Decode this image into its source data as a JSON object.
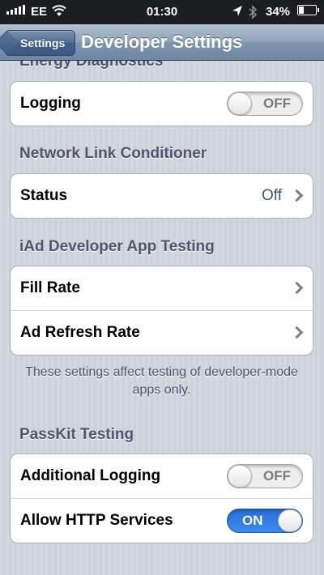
{
  "status_bar": {
    "carrier": "EE",
    "time": "01:30",
    "battery_percent": "34%",
    "battery_level": 0.34
  },
  "nav": {
    "back_label": "Settings",
    "title": "Developer Settings"
  },
  "sections": {
    "energy_header": "Energy Diagnostics",
    "logging_label": "Logging",
    "logging_toggle": "OFF",
    "network_header": "Network Link Conditioner",
    "status_label": "Status",
    "status_value": "Off",
    "iad_header": "iAd Developer App Testing",
    "fill_rate_label": "Fill Rate",
    "ad_refresh_label": "Ad Refresh Rate",
    "iad_footer": "These settings affect testing of developer-mode apps only.",
    "passkit_header": "PassKit Testing",
    "additional_logging_label": "Additional Logging",
    "additional_logging_toggle": "OFF",
    "allow_http_label": "Allow HTTP Services",
    "allow_http_toggle": "ON"
  },
  "colors": {
    "toggle_on": "#2a6fd8",
    "value_text": "#385487",
    "section_header": "#4c566c"
  }
}
